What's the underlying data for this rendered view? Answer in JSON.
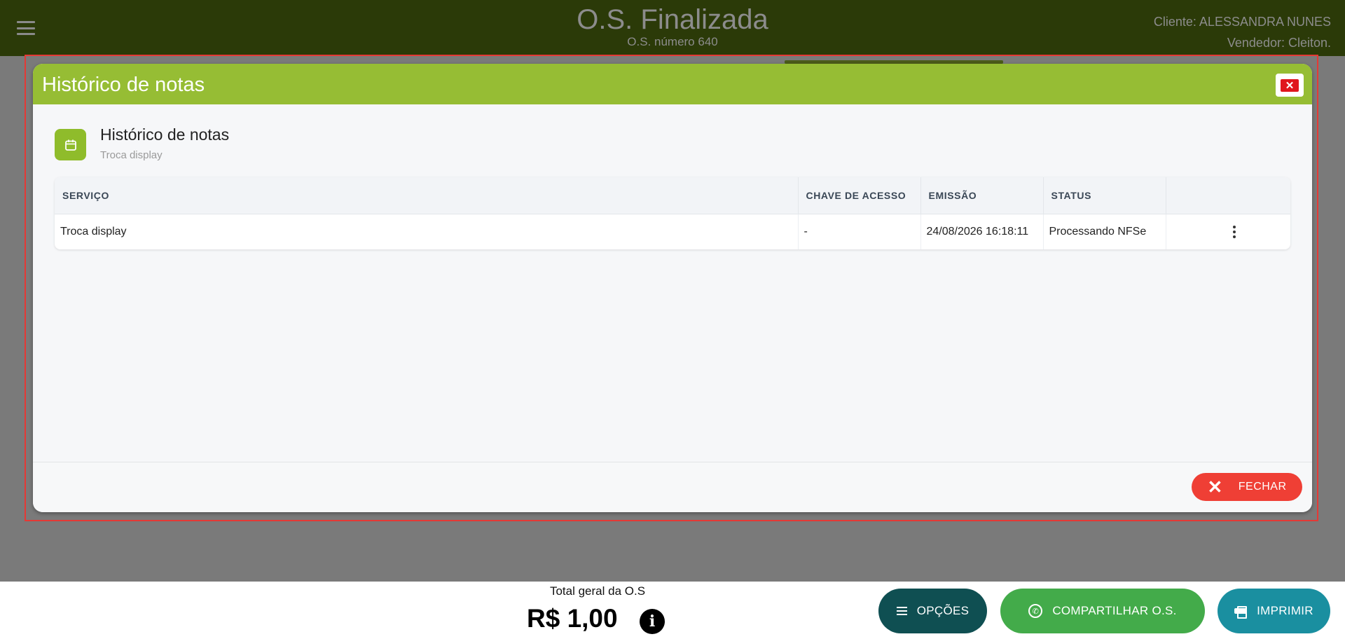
{
  "topbar": {
    "title": "O.S. Finalizada",
    "subtitle": "O.S. número 640",
    "client": "Cliente: ALESSANDRA NUNES",
    "seller": "Vendedor: Cleiton."
  },
  "modal": {
    "title": "Histórico de notas",
    "close_symbol": "✕",
    "card_title": "Histórico de notas",
    "card_subtitle": "Troca display",
    "table": {
      "headers": [
        "SERVIÇO",
        "CHAVE DE ACESSO",
        "EMISSÃO",
        "STATUS",
        ""
      ],
      "rows": [
        {
          "servico": "Troca display",
          "chave": "-",
          "emissao": "24/08/2026 16:18:11",
          "status": "Processando NFSe"
        }
      ]
    },
    "footer": {
      "close_label": "FECHAR"
    }
  },
  "bottom": {
    "total_label": "Total geral da O.S",
    "total_value": "R$ 1,00",
    "buttons": {
      "options": "OPÇÕES",
      "share": "COMPARTILHAR O.S.",
      "print": "IMPRIMIR"
    }
  },
  "colors": {
    "header_green": "#96bd34",
    "close_red": "#ef3f35",
    "options_teal": "#0f4f52",
    "share_green": "#43ab4a",
    "print_blue": "#1a8fa0"
  }
}
